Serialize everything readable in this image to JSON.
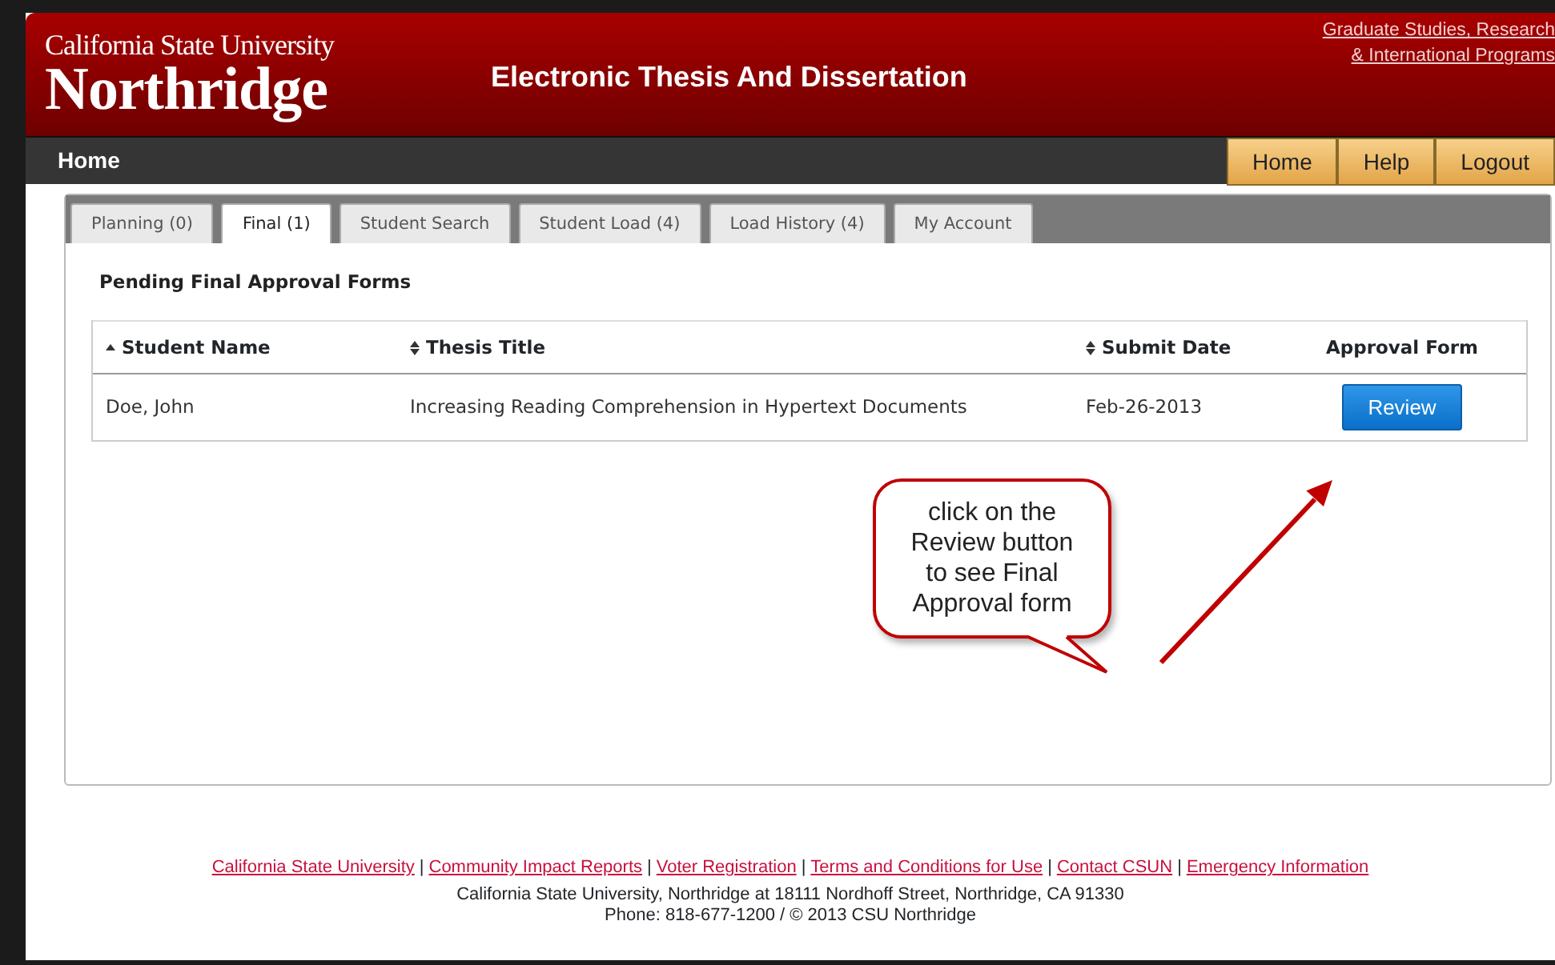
{
  "header": {
    "logo_top": "California State University",
    "logo_name": "Northridge",
    "title": "Electronic Thesis And Dissertation",
    "links": [
      "Graduate Studies, Research",
      "& International Programs"
    ]
  },
  "navbar": {
    "label": "Home",
    "buttons": [
      "Home",
      "Help",
      "Logout"
    ]
  },
  "tabs": [
    {
      "label": "Planning (0)",
      "selected": false
    },
    {
      "label": "Final (1)",
      "selected": true
    },
    {
      "label": "Student Search",
      "selected": false
    },
    {
      "label": "Student Load (4)",
      "selected": false
    },
    {
      "label": "Load History (4)",
      "selected": false
    },
    {
      "label": "My Account",
      "selected": false
    }
  ],
  "section_title": "Pending Final Approval Forms",
  "table": {
    "columns": [
      {
        "label": "Student Name",
        "kind": "sorted"
      },
      {
        "label": "Thesis Title",
        "kind": "sortable"
      },
      {
        "label": "Submit Date",
        "kind": "sortable"
      },
      {
        "label": "Approval Form",
        "kind": "plain"
      }
    ],
    "rows": [
      {
        "cells": [
          "Doe, John",
          "Increasing Reading Comprehension in Hypertext Documents",
          "Feb-26-2013"
        ],
        "button": "Review"
      }
    ]
  },
  "annotation": {
    "callout": "click on the\nReview button\nto see Final\nApproval form"
  },
  "footer": {
    "links": [
      "California State University",
      "Community Impact Reports",
      "Voter Registration",
      "Terms and Conditions for Use",
      "Contact CSUN",
      "Emergency Information"
    ],
    "separator": "|",
    "address": "California State University, Northridge at 18111 Nordhoff Street, Northridge, CA 91330",
    "contact": "Phone: 818-677-1200 / © 2013 CSU Northridge"
  }
}
